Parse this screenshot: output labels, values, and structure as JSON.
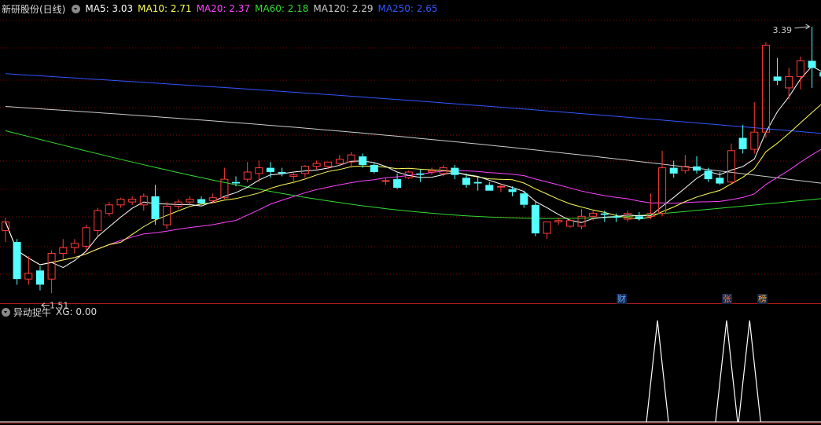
{
  "header": {
    "title": "新研股份(日线)",
    "ma": [
      {
        "label": "MA5: 3.03",
        "color": "#ffffff"
      },
      {
        "label": "MA10: 2.71",
        "color": "#ffff55"
      },
      {
        "label": "MA20: 2.37",
        "color": "#ff44ff"
      },
      {
        "label": "MA60: 2.18",
        "color": "#33dd33"
      },
      {
        "label": "MA120: 2.29",
        "color": "#cccccc"
      },
      {
        "label": "MA250: 2.65",
        "color": "#3355ff"
      }
    ]
  },
  "indicator": {
    "title": "异动捉牛",
    "value_label": "XG: 0.00"
  },
  "annotations": {
    "high_label": "3.39",
    "low_label": "1.51"
  },
  "event_markers": [
    {
      "label": "财",
      "color": "#66aaff"
    },
    {
      "label": "张",
      "color": "#ff7744"
    },
    {
      "label": "榜",
      "color": "#ffaa33"
    }
  ],
  "colors": {
    "background": "#000000",
    "up_candle": "#ff3c3c",
    "down_candle": "#54ffff",
    "grid": "#8b0000",
    "separator": "#b01c1c",
    "signal_line": "#ffffff"
  },
  "chart_data": {
    "type": "candlestick",
    "price_range": [
      1.45,
      3.45
    ],
    "candles": [
      [
        1.96,
        2.05,
        1.88,
        2.02
      ],
      [
        1.88,
        1.9,
        1.58,
        1.62
      ],
      [
        1.62,
        1.78,
        1.58,
        1.66
      ],
      [
        1.68,
        1.71,
        1.54,
        1.58
      ],
      [
        1.62,
        1.82,
        1.52,
        1.8
      ],
      [
        1.8,
        1.9,
        1.76,
        1.84
      ],
      [
        1.84,
        1.9,
        1.8,
        1.87
      ],
      [
        1.85,
        2.0,
        1.82,
        1.98
      ],
      [
        1.96,
        2.12,
        1.92,
        2.1
      ],
      [
        2.08,
        2.16,
        2.06,
        2.14
      ],
      [
        2.14,
        2.19,
        2.12,
        2.18
      ],
      [
        2.16,
        2.2,
        2.14,
        2.18
      ],
      [
        2.14,
        2.22,
        2.1,
        2.2
      ],
      [
        2.2,
        2.28,
        2.0,
        2.04
      ],
      [
        2.0,
        2.16,
        1.97,
        2.13
      ],
      [
        2.13,
        2.18,
        2.11,
        2.16
      ],
      [
        2.16,
        2.2,
        2.13,
        2.18
      ],
      [
        2.18,
        2.2,
        2.14,
        2.15
      ],
      [
        2.17,
        2.22,
        2.15,
        2.19
      ],
      [
        2.19,
        2.4,
        2.18,
        2.32
      ],
      [
        2.3,
        2.34,
        2.27,
        2.29
      ],
      [
        2.32,
        2.44,
        2.3,
        2.37
      ],
      [
        2.36,
        2.45,
        2.3,
        2.4
      ],
      [
        2.4,
        2.44,
        2.33,
        2.37
      ],
      [
        2.37,
        2.4,
        2.34,
        2.36
      ],
      [
        2.34,
        2.37,
        2.29,
        2.35
      ],
      [
        2.36,
        2.42,
        2.33,
        2.41
      ],
      [
        2.41,
        2.45,
        2.39,
        2.43
      ],
      [
        2.41,
        2.44,
        2.39,
        2.44
      ],
      [
        2.43,
        2.49,
        2.41,
        2.46
      ],
      [
        2.44,
        2.51,
        2.4,
        2.49
      ],
      [
        2.48,
        2.5,
        2.4,
        2.42
      ],
      [
        2.42,
        2.44,
        2.36,
        2.37
      ],
      [
        2.31,
        2.33,
        2.28,
        2.31
      ],
      [
        2.32,
        2.36,
        2.25,
        2.26
      ],
      [
        2.33,
        2.38,
        2.32,
        2.37
      ],
      [
        2.36,
        2.39,
        2.3,
        2.35
      ],
      [
        2.37,
        2.4,
        2.35,
        2.38
      ],
      [
        2.36,
        2.42,
        2.34,
        2.4
      ],
      [
        2.4,
        2.42,
        2.32,
        2.35
      ],
      [
        2.33,
        2.36,
        2.26,
        2.28
      ],
      [
        2.3,
        2.34,
        2.24,
        2.29
      ],
      [
        2.28,
        2.3,
        2.24,
        2.24
      ],
      [
        2.27,
        2.29,
        2.23,
        2.27
      ],
      [
        2.25,
        2.27,
        2.2,
        2.23
      ],
      [
        2.22,
        2.24,
        2.12,
        2.14
      ],
      [
        2.14,
        2.16,
        1.92,
        1.94
      ],
      [
        1.94,
        2.02,
        1.9,
        2.02
      ],
      [
        2.02,
        2.05,
        2.0,
        2.03
      ],
      [
        1.99,
        2.04,
        1.98,
        2.03
      ],
      [
        1.99,
        2.11,
        1.97,
        2.06
      ],
      [
        2.06,
        2.1,
        2.03,
        2.08
      ],
      [
        2.08,
        2.1,
        2.02,
        2.07
      ],
      [
        2.06,
        2.08,
        2.02,
        2.05
      ],
      [
        2.04,
        2.1,
        2.02,
        2.08
      ],
      [
        2.06,
        2.09,
        2.03,
        2.04
      ],
      [
        2.06,
        2.22,
        2.04,
        2.08
      ],
      [
        2.08,
        2.52,
        2.06,
        2.4
      ],
      [
        2.4,
        2.45,
        2.33,
        2.36
      ],
      [
        2.38,
        2.49,
        2.36,
        2.41
      ],
      [
        2.41,
        2.48,
        2.36,
        2.38
      ],
      [
        2.38,
        2.4,
        2.3,
        2.32
      ],
      [
        2.33,
        2.37,
        2.28,
        2.29
      ],
      [
        2.3,
        2.57,
        2.28,
        2.52
      ],
      [
        2.61,
        2.7,
        2.5,
        2.53
      ],
      [
        2.53,
        2.86,
        2.5,
        2.65
      ],
      [
        2.65,
        3.28,
        2.61,
        3.26
      ],
      [
        3.04,
        3.17,
        2.98,
        3.01
      ],
      [
        2.96,
        3.1,
        2.88,
        3.04
      ],
      [
        3.04,
        3.18,
        2.95,
        3.15
      ],
      [
        3.15,
        3.39,
        2.96,
        3.1
      ],
      [
        3.07,
        3.2,
        3.0,
        3.04
      ]
    ],
    "ma_values": {
      "MA5": 3.03,
      "MA10": 2.71,
      "MA20": 2.37,
      "MA60": 2.18,
      "MA120": 2.29,
      "MA250": 2.65
    },
    "indicator_series": {
      "name": "XG",
      "spikes_at_candle_index": [
        57,
        63,
        65
      ],
      "current_value": 0.0
    }
  }
}
